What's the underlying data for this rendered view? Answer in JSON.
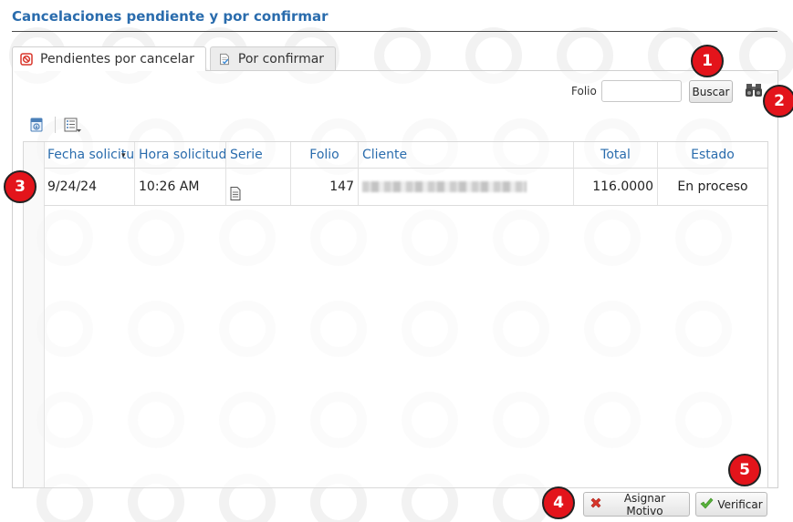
{
  "page": {
    "title": "Cancelaciones pendiente y por confirmar"
  },
  "tabs": [
    {
      "label": "Pendientes por cancelar",
      "icon": "cancel-doc-icon",
      "active": true
    },
    {
      "label": "Por confirmar",
      "icon": "confirm-doc-icon",
      "active": false
    }
  ],
  "search": {
    "folio_label": "Folio",
    "folio_value": "",
    "folio_placeholder": "",
    "buscar_label": "Buscar"
  },
  "grid": {
    "columns": [
      "Fecha solicitud",
      "Hora solicitud",
      "Serie",
      "Folio",
      "Cliente",
      "Total",
      "Estado"
    ],
    "rows": [
      {
        "fecha": "9/24/24",
        "hora": "10:26 AM",
        "serie_icon": "document-icon",
        "folio": "147",
        "cliente": "",
        "total": "116.0000",
        "estado": "En proceso"
      }
    ]
  },
  "actions": {
    "asignar_label": "Asignar Motivo",
    "verificar_label": "Verificar"
  },
  "badges": [
    "1",
    "2",
    "3",
    "4",
    "5"
  ],
  "colors": {
    "accent": "#2a6cad",
    "badge": "#e3141b",
    "cancel_icon": "#d9362b",
    "verify_icon": "#3a9a2a"
  }
}
